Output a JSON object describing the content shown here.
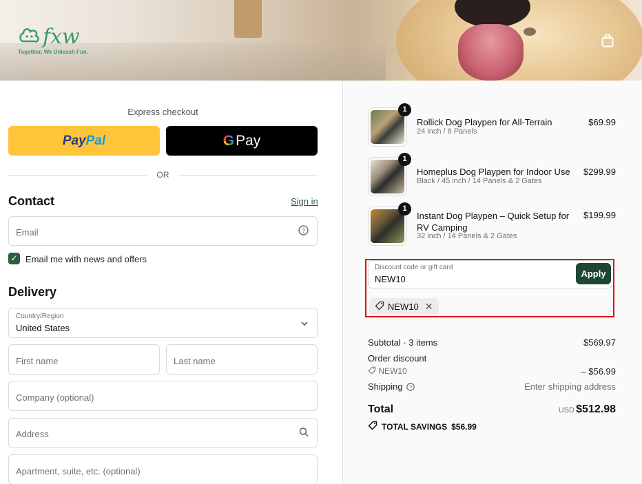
{
  "brand": {
    "logo_text": "fxw",
    "tagline": "Together, We Unleash Fun."
  },
  "express": {
    "label": "Express checkout",
    "paypal_part1": "Pay",
    "paypal_part2": "Pal",
    "gpay_g": "G",
    "gpay_text": "Pay",
    "or": "OR"
  },
  "contact": {
    "title": "Contact",
    "signin": "Sign in",
    "email_placeholder": "Email",
    "news_label": "Email me with news and offers"
  },
  "delivery": {
    "title": "Delivery",
    "country_label": "Country/Region",
    "country_value": "United States",
    "first_name": "First name",
    "last_name": "Last name",
    "company": "Company (optional)",
    "address": "Address",
    "apartment": "Apartment, suite, etc. (optional)"
  },
  "items": [
    {
      "qty": "1",
      "name": "Rollick Dog Playpen for All-Terrain",
      "variant": "24 inch / 8 Panels",
      "price": "$69.99"
    },
    {
      "qty": "1",
      "name": "Homeplus Dog Playpen for Indoor Use",
      "variant": "Black / 45 inch / 14 Panels & 2 Gates",
      "price": "$299.99"
    },
    {
      "qty": "1",
      "name": "Instant Dog Playpen – Quick Setup for RV Camping",
      "variant": "32 inch / 14 Panels & 2 Gates",
      "price": "$199.99"
    }
  ],
  "discount": {
    "label": "Discount code or gift card",
    "value": "NEW10",
    "apply": "Apply",
    "chip": "NEW10"
  },
  "summary": {
    "subtotal_label": "Subtotal · 3 items",
    "subtotal_value": "$569.97",
    "order_discount_label": "Order discount",
    "discount_code": "NEW10",
    "discount_value": "– $56.99",
    "shipping_label": "Shipping",
    "shipping_value": "Enter shipping address",
    "total_label": "Total",
    "currency": "USD",
    "total_value": "$512.98",
    "savings_label": "TOTAL SAVINGS",
    "savings_value": "$56.99"
  },
  "colors": {
    "accent": "#2a5e3f",
    "apply_bg": "#1d4733",
    "paypal_yellow": "#ffc439",
    "highlight_red": "#e01010"
  }
}
